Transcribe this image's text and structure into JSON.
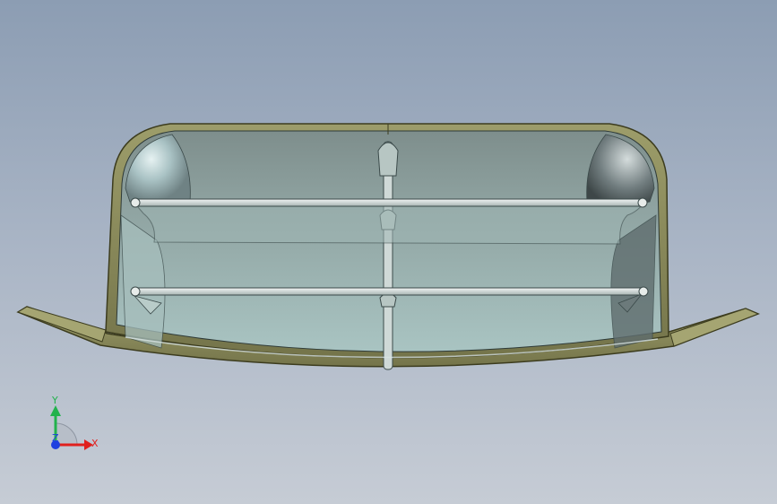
{
  "viewport": {
    "background_top": "#8c9db3",
    "background_bottom": "#c6ccd5",
    "model": {
      "shell_color": "#8a8a5a",
      "shell_edge_color": "#3c3c1e",
      "interior_color": "#9fb9b7",
      "louver_color": "#d8dfdd"
    }
  },
  "triad": {
    "x_label": "X",
    "y_label": "Y",
    "z_label": "Z",
    "x_color": "#e0201e",
    "y_color": "#22b24c",
    "z_color": "#1f3fe0"
  }
}
